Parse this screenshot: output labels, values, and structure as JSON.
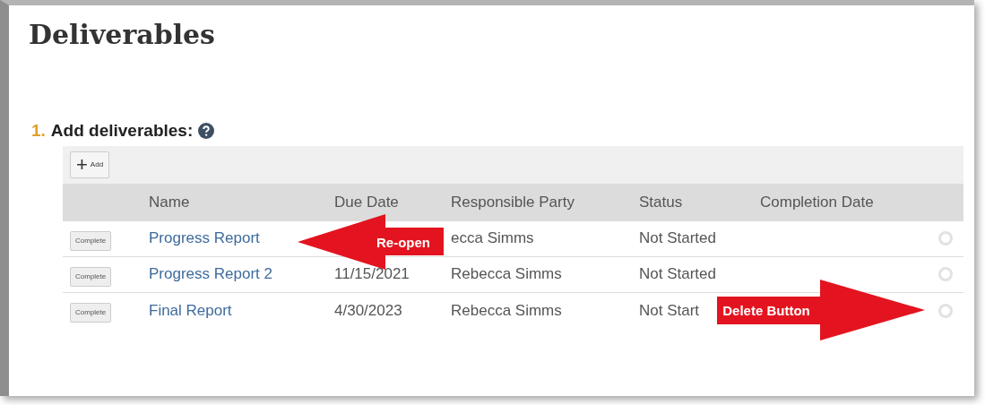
{
  "title": "Deliverables",
  "section": {
    "number": "1.",
    "label": "Add deliverables:"
  },
  "add_button": {
    "symbol": "+",
    "label": "Add"
  },
  "columns": [
    "Name",
    "Due Date",
    "Responsible Party",
    "Status",
    "Completion Date"
  ],
  "rows": [
    {
      "button": "Complete",
      "name": "Progress Report",
      "party": "ecca Simms",
      "status": "Not Started",
      "callout": {
        "text": "Re-open",
        "kind": "left"
      }
    },
    {
      "button": "Complete",
      "name": "Progress Report 2",
      "due_date": "11/15/2021",
      "party": "Rebecca Simms",
      "status": "Not Started"
    },
    {
      "button": "Complete",
      "name": "Final Report",
      "due_date": "4/30/2023",
      "party": "Rebecca Simms",
      "status": "Not Start",
      "callout": {
        "text": "Delete Button",
        "kind": "right"
      }
    }
  ]
}
